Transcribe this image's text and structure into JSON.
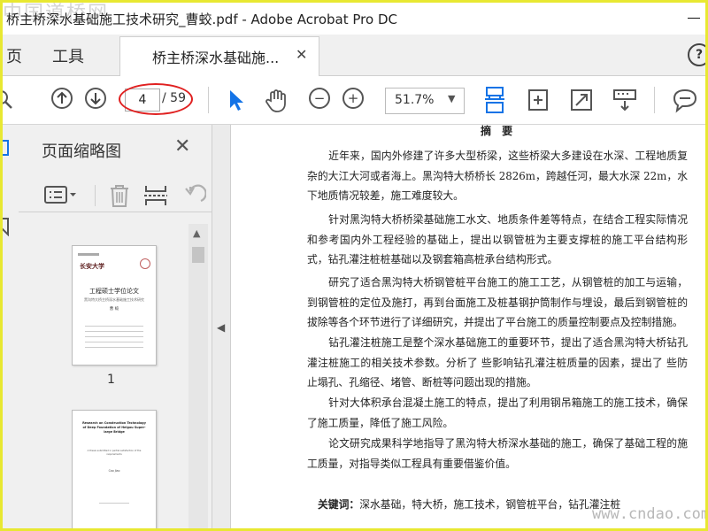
{
  "window": {
    "title": "桥主桥深水基础施工技术研究_曹蛟.pdf - Adobe Acrobat Pro DC",
    "watermark_top": "中国道桥网"
  },
  "tabs": {
    "home_partial": "页",
    "tools": "工具",
    "document": "桥主桥深水基础施..."
  },
  "toolbar": {
    "current_page": "4",
    "total_pages": "/ 59",
    "zoom": "51.7%",
    "highlight_color": "#e02020",
    "accent_color": "#1473e6"
  },
  "panel": {
    "title": "页面缩略图",
    "thumbnails": [
      {
        "page_label": "1",
        "title": "工程硕士学位论文",
        "subtitle": "黑沟特大桥主桥深水基础施工技术研究",
        "author": "曹 蛟"
      },
      {
        "page_label": "",
        "title": "Research on Construction Technology of Deep Foundation of Heigou Super-large Bridge",
        "subtitle": "A thesis submitted in partial satisfaction of the requirements",
        "author": "Cao Jiao"
      }
    ]
  },
  "document": {
    "heading": "摘 要",
    "paragraphs": [
      "近年来，国内外修建了许多大型桥梁，这些桥梁大多建设在水深、工程地质复杂的大江大河或者海上。黑沟特大桥桥长 2826m，跨越任河，最大水深 22m，水下地质情况较差，施工难度较大。",
      "针对黑沟特大桥桥梁基础施工水文、地质条件差等特点，在结合工程实际情况和参考国内外工程经验的基础上，提出以钢管桩为主要支撑桩的施工平台结构形式，钻孔灌注桩桩基础以及钢套箱高桩承台结构形式。",
      "研究了适合黑沟特大桥钢管桩平台施工的施工工艺，从钢管桩的加工与运输，到钢管桩的定位及施打，再到台面施工及桩基钢护筒制作与埋设，最后到钢管桩的拔除等各个环节进行了详细研究，并提出了平台施工的质量控制要点及控制措施。",
      "钻孔灌注桩施工是整个深水基础施工的重要环节，提出了适合黑沟特大桥钻孔灌注桩施工的相关技术参数。分析了 些影响钻孔灌注桩质量的因素，提出了 些防止塌孔、孔缩径、堵管、断桩等问题出现的措施。",
      "针对大体积承台混凝土施工的特点，提出了利用钢吊箱施工的施工技术，确保了施工质量，降低了施工风险。",
      "论文研究成果科学地指导了黑沟特大桥深水基础的施工，确保了基础工程的施工质量，对指导类似工程具有重要借鉴价值。"
    ],
    "keywords_label": "关键词：",
    "keywords": "深水基础，特大桥，施工技术，钢管桩平台，钻孔灌注桩",
    "watermark": "www.cndao.com"
  }
}
